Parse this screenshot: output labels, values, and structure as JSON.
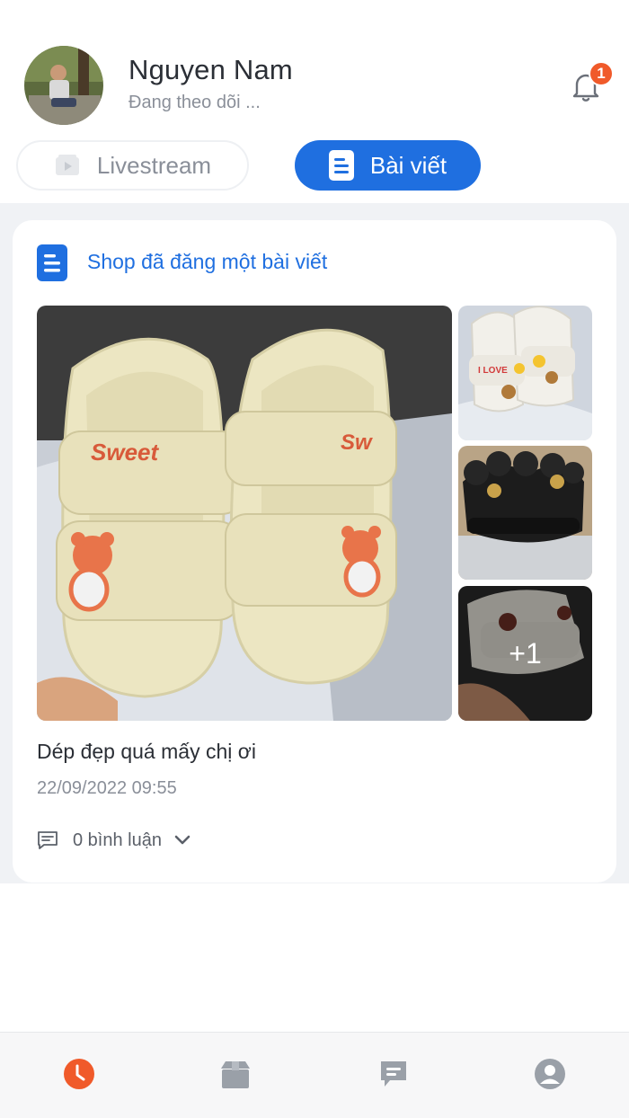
{
  "user": {
    "name": "Nguyen Nam",
    "status": "Đang theo dõi ..."
  },
  "notifications": {
    "badge_count": "1",
    "icon": "bell-icon"
  },
  "tabs": [
    {
      "label": "Livestream",
      "icon": "video-icon",
      "active": false
    },
    {
      "label": "Bài viết",
      "icon": "document-icon",
      "active": true
    }
  ],
  "post": {
    "header": "Shop đã đăng một bài viết",
    "header_icon": "document-icon",
    "more_images_label": "+1",
    "caption": "Dép đẹp quá mấy chị ơi",
    "date": "22/09/2022 09:55",
    "comments_label": "0 bình luận"
  },
  "bottom_nav": [
    {
      "name": "clock-icon",
      "active": true
    },
    {
      "name": "box-icon",
      "active": false
    },
    {
      "name": "chat-icon",
      "active": false
    },
    {
      "name": "profile-icon",
      "active": false
    }
  ],
  "colors": {
    "accent": "#1f6fe0",
    "badge": "#f05a2a",
    "nav_active": "#f05a2a",
    "nav_inactive": "#9aa0a8",
    "feed_bg": "#f0f2f5"
  }
}
